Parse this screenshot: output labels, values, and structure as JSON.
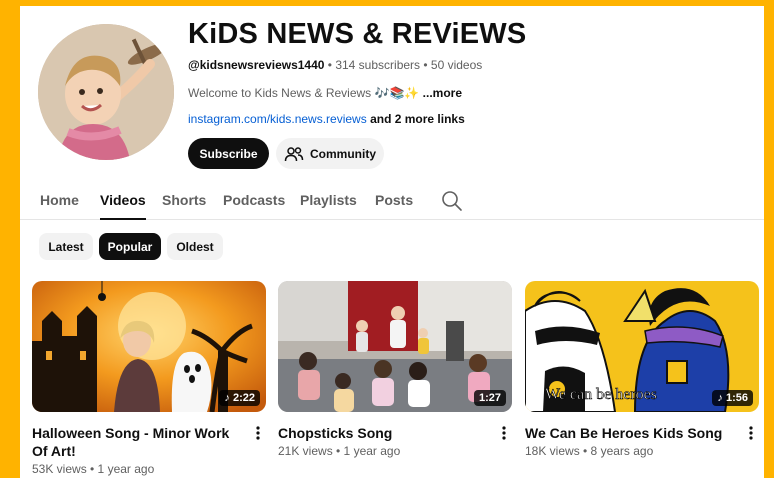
{
  "channel": {
    "name": "KiDS NEWS & REViEWS",
    "handle": "@kidsnewsreviews1440",
    "stats": " • 314 subscribers • 50 videos",
    "description": "Welcome to Kids News & Reviews 🎶📚✨ ",
    "description_more": "...more",
    "link": "instagram.com/kids.news.reviews",
    "extra_links": " and 2 more links",
    "subscribe_label": "Subscribe",
    "community_label": "Community"
  },
  "tabs": [
    {
      "label": "Home",
      "active": false
    },
    {
      "label": "Videos",
      "active": true
    },
    {
      "label": "Shorts",
      "active": false
    },
    {
      "label": "Podcasts",
      "active": false
    },
    {
      "label": "Playlists",
      "active": false
    },
    {
      "label": "Posts",
      "active": false
    }
  ],
  "filters": [
    {
      "label": "Latest",
      "active": false
    },
    {
      "label": "Popular",
      "active": true
    },
    {
      "label": "Oldest",
      "active": false
    }
  ],
  "videos": [
    {
      "title": "Halloween Song - Minor Work Of Art!",
      "duration": "♪ 2:22",
      "views": "53K views",
      "age": "1 year ago",
      "meta": "53K views • 1 year ago"
    },
    {
      "title": "Chopsticks Song",
      "duration": "1:27",
      "views": "21K views",
      "age": "1 year ago",
      "meta": "21K views • 1 year ago"
    },
    {
      "title": "We Can Be Heroes Kids Song",
      "duration": "♪ 1:56",
      "views": "18K views",
      "age": "8 years ago",
      "meta": "18K views • 8 years ago",
      "thumb_caption": "We can be heroes"
    }
  ],
  "colors": {
    "frame": "#ffb300",
    "link": "#065fd4",
    "accent": "#0f0f0f"
  },
  "icons": {
    "community": "people-icon",
    "search": "search-icon",
    "menu": "kebab-menu-icon"
  }
}
